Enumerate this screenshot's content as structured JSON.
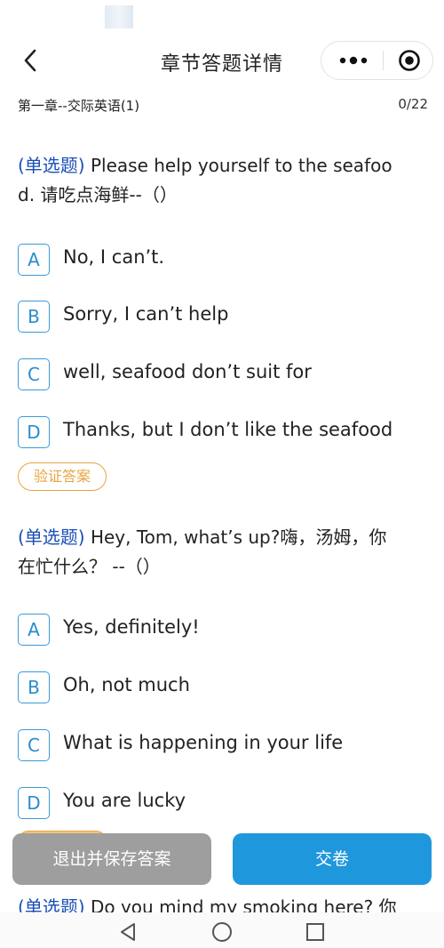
{
  "header": {
    "title": "章节答题详情",
    "back_icon": "chevron-left-icon",
    "more_icon": "more-dots-icon",
    "target_icon": "record-target-icon"
  },
  "chapter": {
    "name": "第一章--交际英语(1)",
    "progress": "0/22"
  },
  "questions": [
    {
      "type": "(单选题)",
      "text_line1": " Please help yourself to the seafoo",
      "text_line2": "d. 请吃点海鲜--（）",
      "options": [
        {
          "letter": "A",
          "text": "No, I can’t."
        },
        {
          "letter": "B",
          "text": "Sorry, I can’t help"
        },
        {
          "letter": "C",
          "text": "well, seafood don’t suit for"
        },
        {
          "letter": "D",
          "text": "Thanks, but I don’t like the seafood"
        }
      ],
      "verify_label": "验证答案"
    },
    {
      "type": "(单选题)",
      "text_line1": " Hey, Tom, what’s up?嗨，汤姆，你",
      "text_line2": "在忙什么？ --（）",
      "options": [
        {
          "letter": "A",
          "text": "Yes, definitely!"
        },
        {
          "letter": "B",
          "text": " Oh, not much"
        },
        {
          "letter": "C",
          "text": "What is happening in your life"
        },
        {
          "letter": "D",
          "text": "You are lucky"
        }
      ]
    },
    {
      "type": "(单选题)",
      "text_line1": " Do you mind my smoking here? 你"
    }
  ],
  "actions": {
    "save_exit_label": "退出并保存答案",
    "submit_label": "交卷"
  },
  "colors": {
    "accent_blue": "#1f97dc",
    "option_border": "#3a9bd8",
    "qtype_blue": "#1a4fb5",
    "verify_orange": "#e8a442",
    "save_gray": "#9e9e9e"
  }
}
